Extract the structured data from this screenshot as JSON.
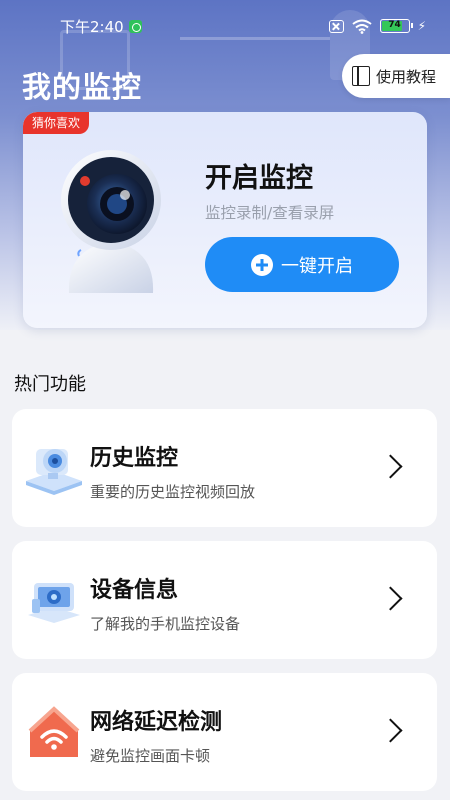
{
  "status_bar": {
    "time": "下午2:40",
    "battery": "74",
    "icons": [
      "notification-icon",
      "sim-icon",
      "wifi-icon",
      "battery-icon",
      "charging-icon"
    ]
  },
  "header": {
    "title": "我的监控",
    "guide_label": "使用教程"
  },
  "hero": {
    "badge": "猜你喜欢",
    "headline": "开启监控",
    "subtitle": "监控录制/查看录屏",
    "button_label": "一键开启"
  },
  "section": {
    "title": "热门功能"
  },
  "features": [
    {
      "title": "历史监控",
      "desc": "重要的历史监控视频回放",
      "icon": "camera-history-icon"
    },
    {
      "title": "设备信息",
      "desc": "了解我的手机监控设备",
      "icon": "device-info-icon"
    },
    {
      "title": "网络延迟检测",
      "desc": "避免监控画面卡顿",
      "icon": "wifi-house-icon"
    }
  ],
  "colors": {
    "accent": "#1f8cf6",
    "badge": "#e8342c",
    "hero_gradient_top": "#5d74c4"
  }
}
